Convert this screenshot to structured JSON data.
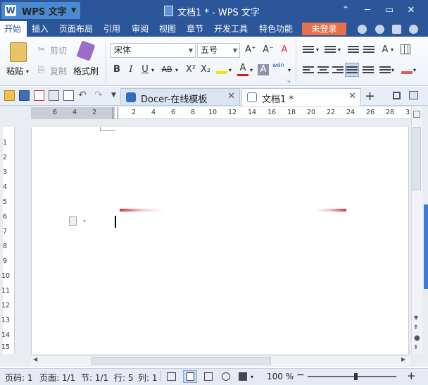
{
  "titlebar": {
    "app_name": "WPS 文字",
    "app_logo_glyph": "W",
    "window_title": "文档1 * - WPS 文字",
    "minimize": "⌃",
    "restore": "▭",
    "close": "✕",
    "collapse": "─"
  },
  "menu": {
    "items": [
      "开始",
      "插入",
      "页面布局",
      "引用",
      "审阅",
      "视图",
      "章节",
      "开发工具",
      "特色功能"
    ],
    "login": "未登录"
  },
  "ribbon": {
    "paste": "粘贴",
    "cut": "剪切",
    "copy": "复制",
    "format_painter": "格式刷",
    "font_name": "宋体",
    "font_size": "五号",
    "bold": "B",
    "italic": "I",
    "underline": "U",
    "strikethrough": "AB",
    "superscript": "X²",
    "subscript": "X₂",
    "pinyin": "wén",
    "grow_font": "A⁺",
    "shrink_font": "A⁻"
  },
  "tabs": [
    {
      "label": "Docer-在线模板",
      "close": "✕"
    },
    {
      "label": "文档1 *",
      "close": "✕"
    }
  ],
  "tabbar": {
    "new_tab": "+"
  },
  "ruler": {
    "h_ticks": [
      "6",
      "4",
      "2",
      "2",
      "4",
      "6",
      "8",
      "10",
      "12",
      "14",
      "16",
      "18",
      "20",
      "22",
      "24",
      "26",
      "28",
      "3"
    ],
    "v_ticks": [
      "1",
      "2",
      "3",
      "4",
      "5",
      "6",
      "7",
      "8",
      "9",
      "10",
      "11",
      "12",
      "13",
      "14",
      "15"
    ]
  },
  "statusbar": {
    "page_num": "页码: 1",
    "page": "页面: 1/1",
    "section": "节: 1/1",
    "row": "行: 5",
    "col": "列: 1",
    "zoom": "100 %",
    "zoom_out": "−",
    "zoom_in": "+"
  },
  "colors": {
    "titlebar": "#2b579a",
    "login_button": "#e8704a",
    "active_menu": "#ffffff"
  }
}
